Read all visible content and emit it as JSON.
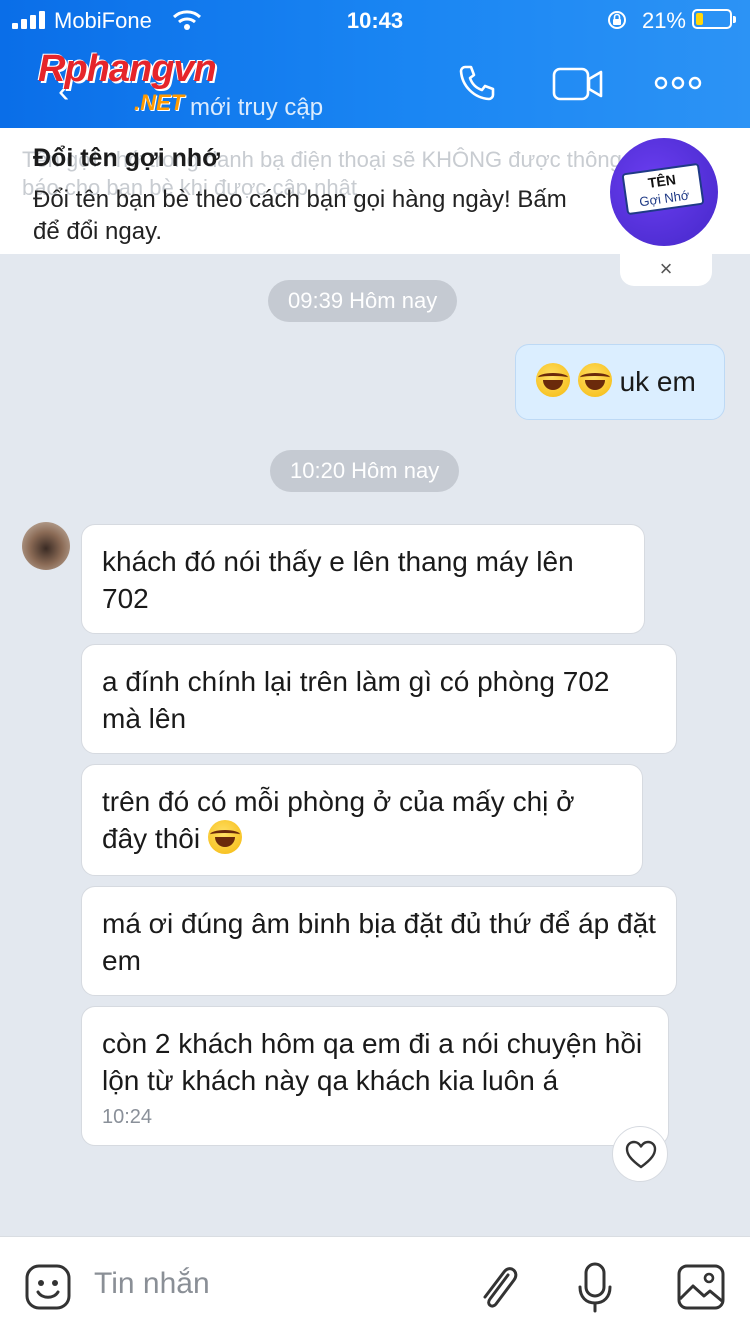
{
  "status_bar": {
    "carrier": "MobiFone",
    "time": "10:43",
    "battery_pct": "21%",
    "battery_level": 0.21
  },
  "header": {
    "logo_main": "Rphangvn",
    "logo_sub": ".NET",
    "subtitle": "mới truy cập",
    "icons": [
      "back-icon",
      "phone-icon",
      "video-call-icon",
      "more-icon"
    ]
  },
  "banner": {
    "ghost_text": "Tên gợi nhớ trong danh bạ điện thoại sẽ KHÔNG được thông báo cho bạn bè khi được cập nhật",
    "title": "Đổi tên gợi nhớ",
    "text": "Đổi tên bạn bè theo cách bạn gọi hàng ngày! Bấm để đổi ngay.",
    "badge_line1": "TÊN",
    "badge_line2": "Gợi Nhớ",
    "close": "×"
  },
  "chat": {
    "separators": [
      "09:39 Hôm nay",
      "10:20 Hôm nay"
    ],
    "my_message": "uk em",
    "messages": [
      "khách đó nói thấy e lên thang máy lên 702",
      "a đính chính lại trên làm gì có phòng 702 mà lên",
      "trên đó có mỗi phòng ở của mấy chị ở đây thôi",
      "má ơi đúng âm binh bịa đặt đủ thứ để áp đặt em",
      "còn 2 khách hôm qa em đi a nói chuyện hồi lộn từ khách này qa khách kia luôn á"
    ],
    "last_time": "10:24"
  },
  "composer": {
    "placeholder": "Tin nhắn",
    "icons": [
      "emoji-icon",
      "attach-icon",
      "microphone-icon",
      "image-icon"
    ]
  },
  "colors": {
    "header_blue": "#1a86f3",
    "chat_bg": "#e3e8ef",
    "mine_bubble": "#dbeeff"
  }
}
